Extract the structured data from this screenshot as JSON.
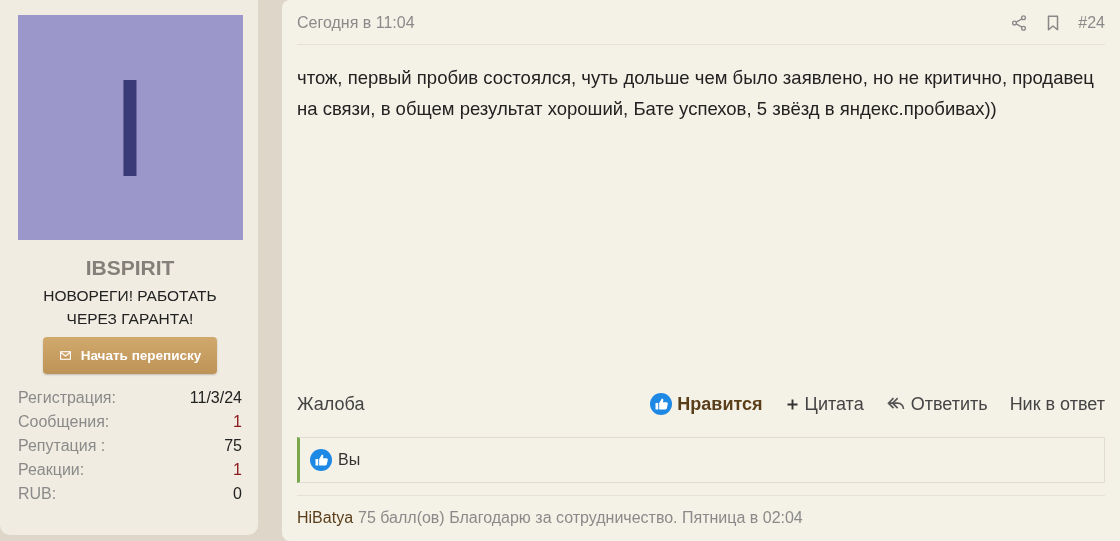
{
  "author": {
    "avatar_letter": "I",
    "name": "IBSPIRIT",
    "title": "НОВОРЕГИ! РАБОТАТЬ ЧЕРЕЗ ГАРАНТА!",
    "message_button": "Начать переписку",
    "stats": [
      {
        "label": "Регистрация:",
        "value": "11/3/24",
        "color": "#222222"
      },
      {
        "label": "Сообщения:",
        "value": "1",
        "color": "#8b1a1a"
      },
      {
        "label": "Репутация :",
        "value": "75",
        "color": "#222222"
      },
      {
        "label": "Реакции:",
        "value": "1",
        "color": "#8b1a1a"
      },
      {
        "label": "RUB:",
        "value": "0",
        "color": "#222222"
      }
    ]
  },
  "post": {
    "time": "Сегодня в 11:04",
    "number": "#24",
    "text": "чтож, первый пробив состоялся, чуть дольше чем было заявлено, но не критично, продавец на связи, в общем результат хороший, Бате успехов, 5 звёзд в яндекс.пробивах))",
    "report": "Жалоба",
    "actions": [
      {
        "kind": "like",
        "label": "Нравится",
        "selected": true
      },
      {
        "kind": "quote",
        "label": "Цитата"
      },
      {
        "kind": "reply",
        "label": "Ответить"
      },
      {
        "kind": "mention",
        "label": "Ник в ответ"
      }
    ],
    "reactions": "Вы",
    "signature": {
      "user": "HiBatya",
      "text": "75 балл(ов) Благодарю за сотрудничество. Пятница в 02:04"
    }
  }
}
